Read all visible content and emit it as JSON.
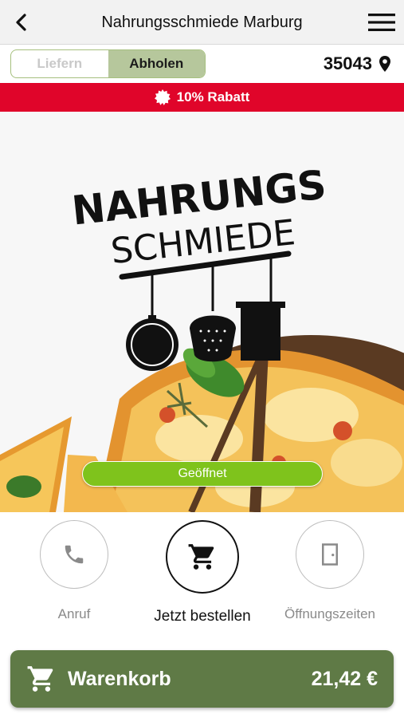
{
  "header": {
    "title": "Nahrungsschmiede Marburg",
    "back_icon": "chevron-left-icon",
    "menu_icon": "hamburger-menu-icon"
  },
  "mode": {
    "deliver_label": "Liefern",
    "pickup_label": "Abholen",
    "selected": "Abholen",
    "zip": "35043",
    "location_icon": "map-pin-icon"
  },
  "promo": {
    "text": "10% Rabatt",
    "icon": "badge-icon",
    "color": "#e0052a"
  },
  "hero": {
    "logo_line1": "NAHRUNGS",
    "logo_line2": "SCHMIEDE",
    "status_label": "Geöffnet",
    "status_color": "#7fc31c"
  },
  "actions": {
    "call_label": "Anruf",
    "order_label": "Jetzt bestellen",
    "hours_label": "Öffnungszeiten"
  },
  "cart": {
    "label": "Warenkorb",
    "total": "21,42 €",
    "color": "#5f7a46"
  }
}
